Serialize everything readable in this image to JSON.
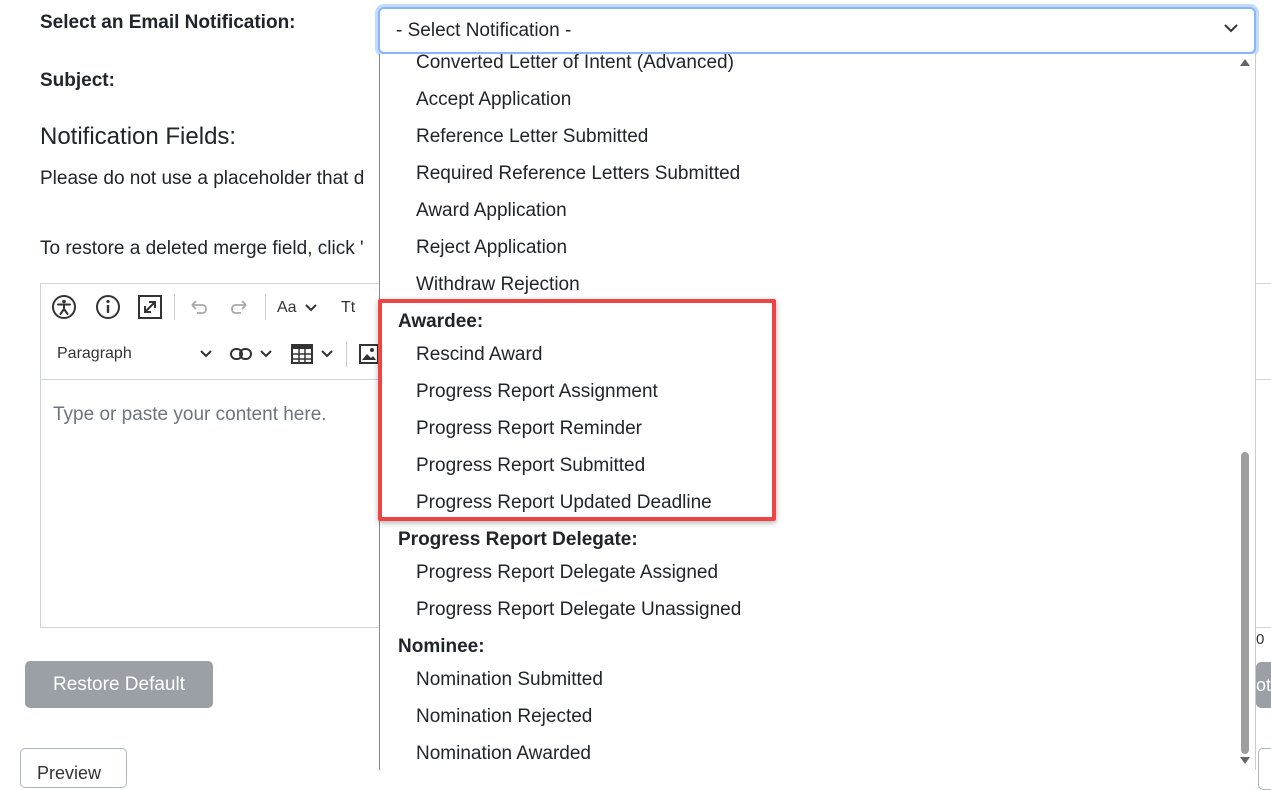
{
  "form": {
    "select_label": "Select an Email Notification:",
    "subject_label": "Subject:",
    "fields_heading": "Notification Fields:",
    "placeholder_note": "Please do not use a placeholder that d",
    "restore_note": "To restore a deleted merge field, click '",
    "editor_placeholder": "Type or paste your content here.",
    "restore_button": "Restore Default",
    "preview_button": "Preview",
    "right_fragment": "ot",
    "counter_fragment": "0"
  },
  "editor_toolbar": {
    "font_size_label": "Aa",
    "font_family_label": "Tt",
    "heading_select": "Paragraph"
  },
  "select": {
    "value": "- Select Notification -"
  },
  "dropdown": {
    "items": [
      {
        "type": "option",
        "label": "Converted Letter of Intent (Advanced)"
      },
      {
        "type": "option",
        "label": "Accept Application"
      },
      {
        "type": "option",
        "label": "Reference Letter Submitted"
      },
      {
        "type": "option",
        "label": "Required Reference Letters Submitted"
      },
      {
        "type": "option",
        "label": "Award Application"
      },
      {
        "type": "option",
        "label": "Reject Application"
      },
      {
        "type": "option",
        "label": "Withdraw Rejection"
      },
      {
        "type": "group",
        "label": "Awardee:"
      },
      {
        "type": "option",
        "label": "Rescind Award"
      },
      {
        "type": "option",
        "label": "Progress Report Assignment"
      },
      {
        "type": "option",
        "label": "Progress Report Reminder"
      },
      {
        "type": "option",
        "label": "Progress Report Submitted"
      },
      {
        "type": "option",
        "label": "Progress Report Updated Deadline"
      },
      {
        "type": "group",
        "label": "Progress Report Delegate:"
      },
      {
        "type": "option",
        "label": "Progress Report Delegate Assigned"
      },
      {
        "type": "option",
        "label": "Progress Report Delegate Unassigned"
      },
      {
        "type": "group",
        "label": "Nominee:"
      },
      {
        "type": "option",
        "label": "Nomination Submitted"
      },
      {
        "type": "option",
        "label": "Nomination Rejected"
      },
      {
        "type": "option",
        "label": "Nomination Awarded"
      }
    ]
  },
  "colors": {
    "highlight": "#ef4444",
    "focus_border": "#86b7fe",
    "button_gray": "#9aa0a6"
  }
}
